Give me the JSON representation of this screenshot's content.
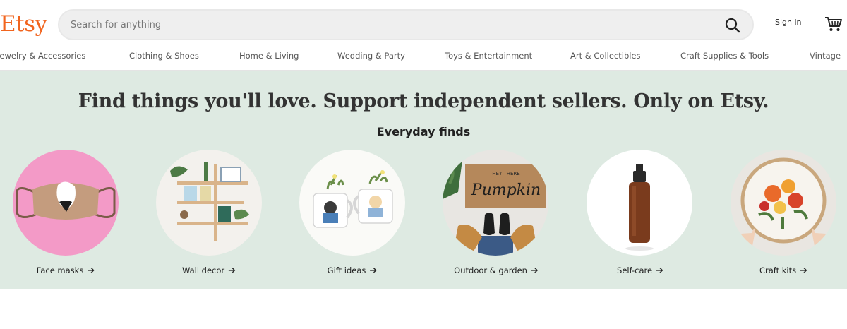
{
  "header": {
    "logo": "Etsy",
    "search": {
      "placeholder": "Search for anything"
    },
    "sign_in": "Sign in",
    "cart_icon": "cart-icon",
    "search_icon": "search-icon"
  },
  "nav": {
    "categories": [
      "Jewelry & Accessories",
      "Clothing & Shoes",
      "Home & Living",
      "Wedding & Party",
      "Toys & Entertainment",
      "Art & Collectibles",
      "Craft Supplies & Tools",
      "Vintage"
    ]
  },
  "hero": {
    "headline": "Find things you'll love. Support independent sellers. Only on Etsy.",
    "subheading": "Everyday finds",
    "background": "#deeae2",
    "arrow_icon": "arrow-right-icon",
    "cards": [
      {
        "label": "Face masks"
      },
      {
        "label": "Wall decor"
      },
      {
        "label": "Gift ideas"
      },
      {
        "label": "Outdoor & garden"
      },
      {
        "label": "Self-care"
      },
      {
        "label": "Craft kits"
      }
    ]
  },
  "colors": {
    "brand": "#f1641e",
    "text": "#222222"
  },
  "doormat_text": {
    "small": "HEY THERE",
    "large": "Pumpkin"
  }
}
